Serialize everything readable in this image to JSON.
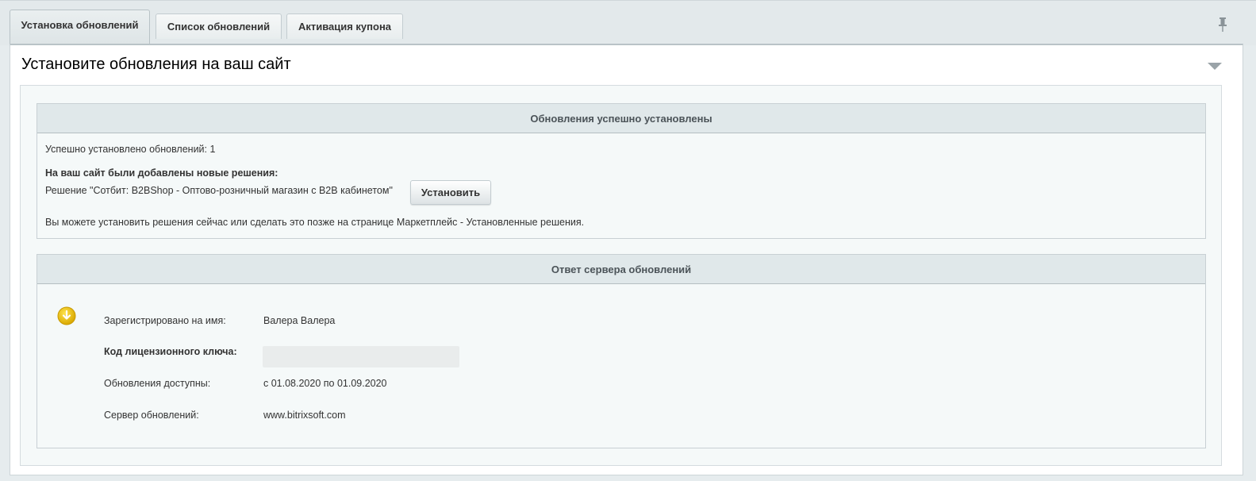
{
  "tabs": [
    {
      "label": "Установка обновлений",
      "active": true
    },
    {
      "label": "Список обновлений",
      "active": false
    },
    {
      "label": "Активация купона",
      "active": false
    }
  ],
  "panel": {
    "title": "Установите обновления на ваш сайт"
  },
  "success_box": {
    "header": "Обновления успешно установлены",
    "installed_count": "Успешно установлено обновлений: 1",
    "new_solutions_heading": "На ваш сайт были добавлены новые решения:",
    "solution_text": "Решение \"Сотбит: B2BShop - Оптово-розничный магазин с B2B кабинетом\"",
    "install_button": "Установить",
    "note": "Вы можете установить решения сейчас или сделать это позже на странице Маркетплейс - Установленные решения."
  },
  "server_box": {
    "header": "Ответ сервера обновлений",
    "rows": [
      {
        "label": "Зарегистрировано на имя:",
        "value": "Валера Валера"
      },
      {
        "label": "Код лицензионного ключа:",
        "value": ""
      },
      {
        "label": "Обновления доступны:",
        "value": "с 01.08.2020 по 01.09.2020"
      },
      {
        "label": "Сервер обновлений:",
        "value": "www.bitrixsoft.com"
      }
    ]
  },
  "colors": {
    "accent_icon": "#f5c400",
    "header_bg": "#e0e8ea"
  }
}
